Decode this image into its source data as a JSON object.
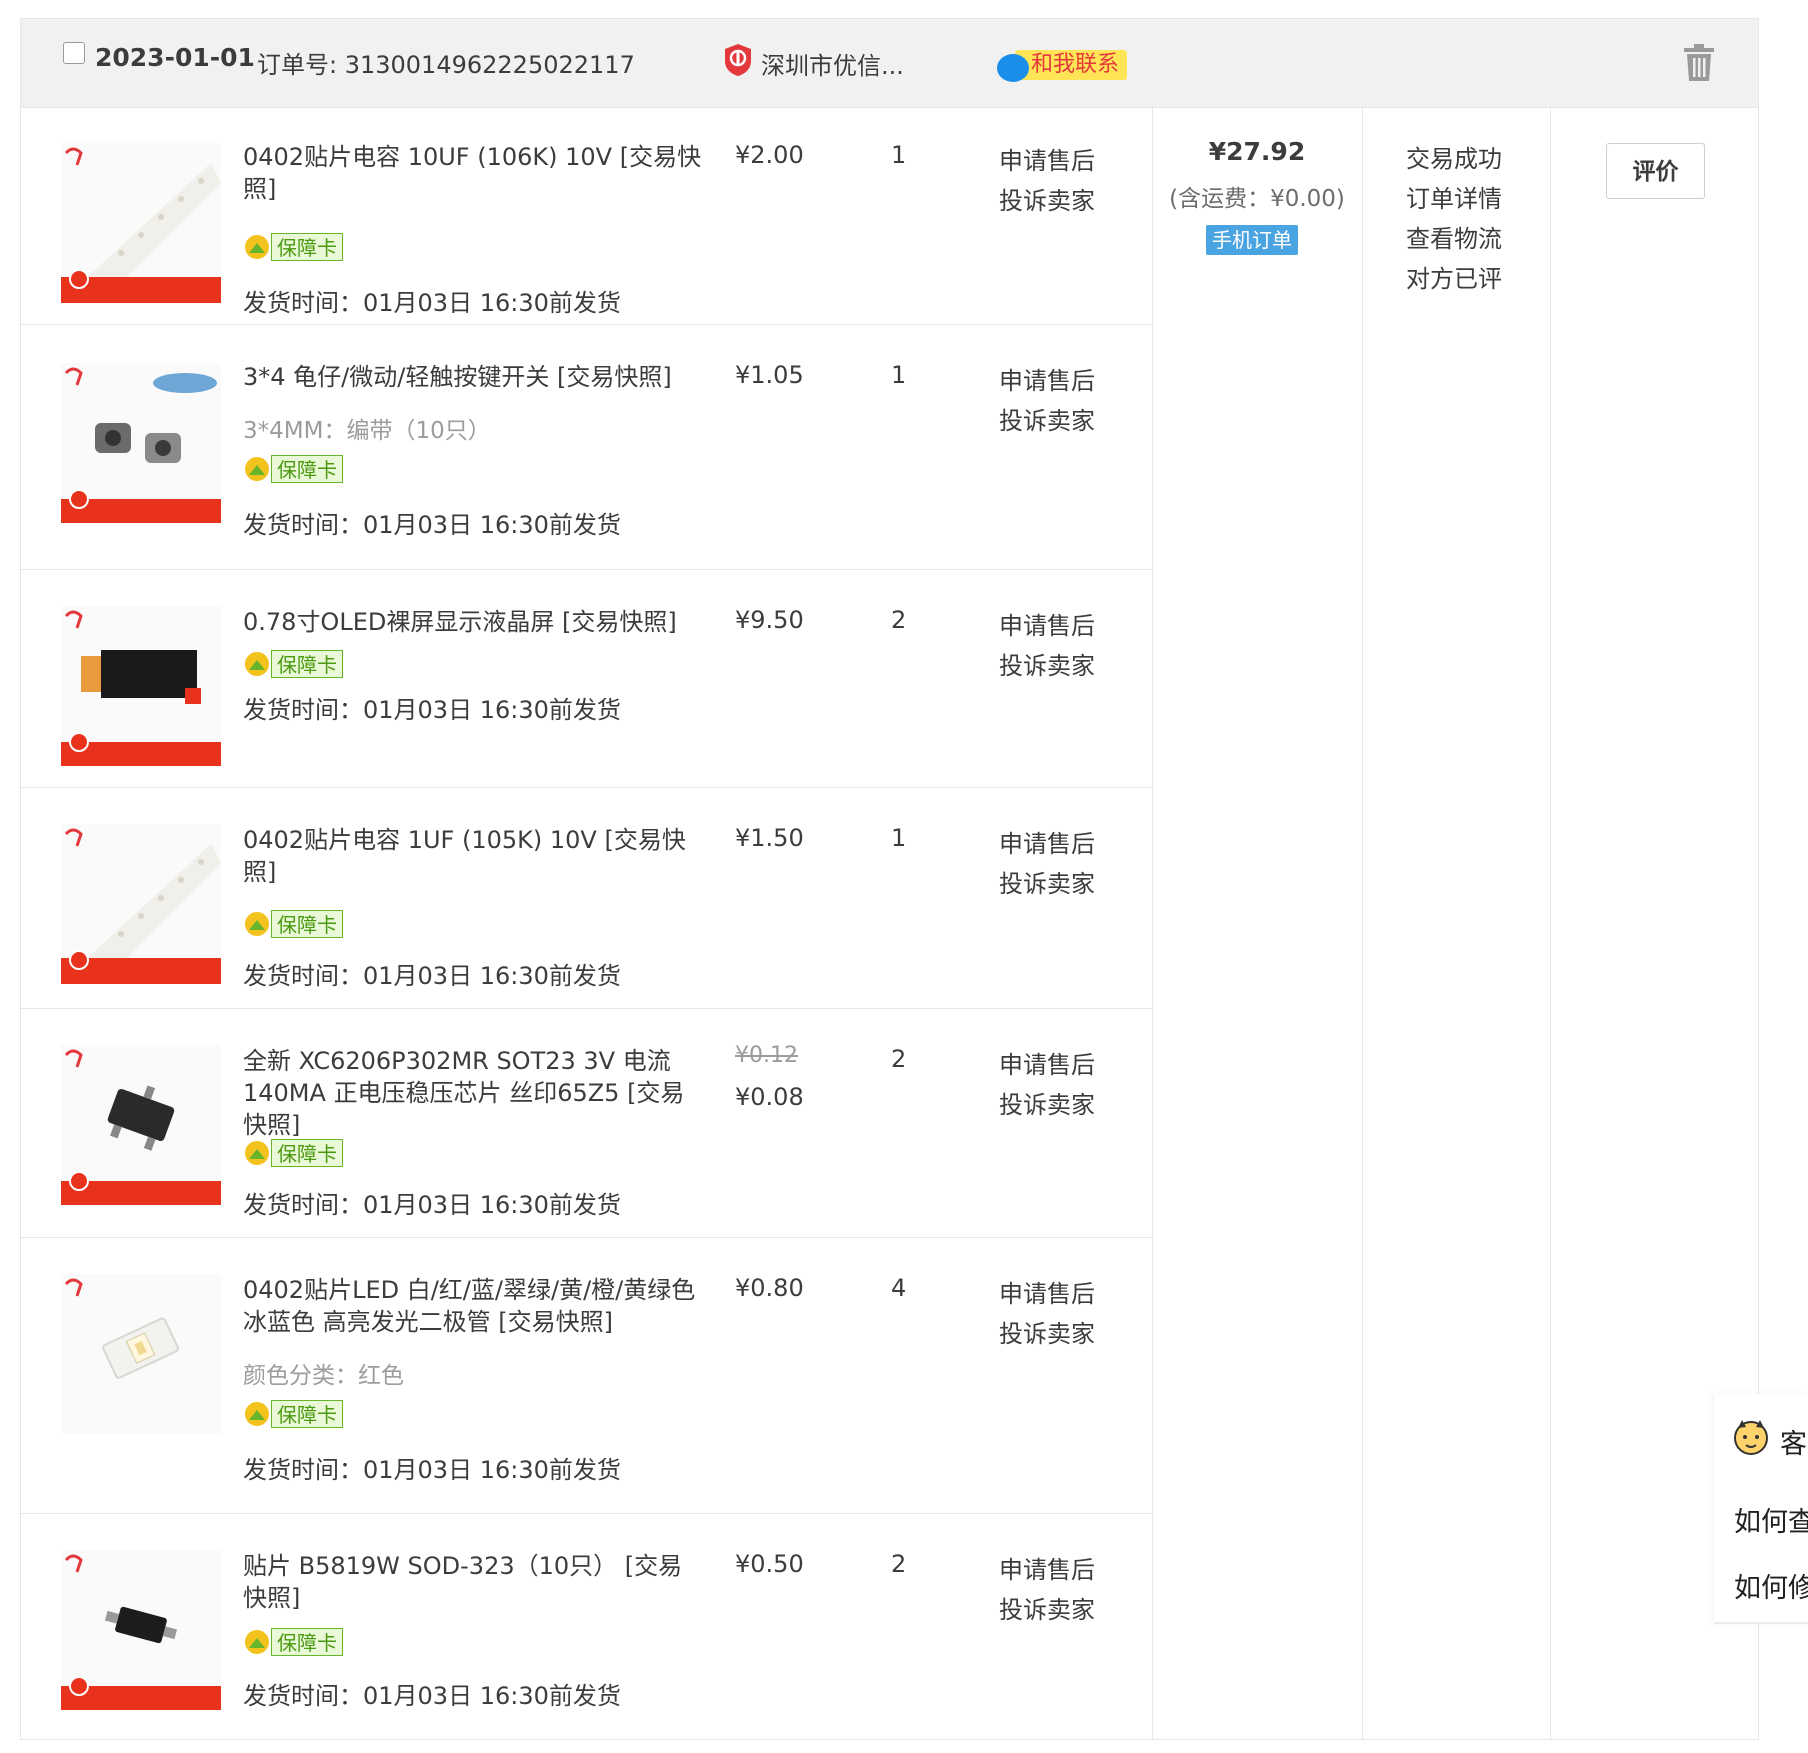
{
  "order": {
    "date": "2023-01-01",
    "order_no": "订单号: 3130014962225022117",
    "shop_name": "深圳市优信...",
    "chat_label": "和我联系",
    "total_price": "¥27.92",
    "shipping_note": "(含运费：¥0.00)",
    "mobile_badge": "手机订单",
    "status_lines": [
      "交易成功",
      "订单详情",
      "查看物流",
      "对方已评"
    ],
    "review_button": "评价",
    "items": [
      {
        "title": "0402贴片电容 10UF (106K) 10V [交易快照]",
        "sku": "",
        "guarantee": "保障卡",
        "ship_time": "发货时间：01月03日 16:30前发货",
        "price_old": "",
        "price": "¥2.00",
        "qty": "1",
        "after_sale": "申请售后",
        "complain": "投诉卖家"
      },
      {
        "title": "3*4 龟仔/微动/轻触按键开关 [交易快照]",
        "sku": "3*4MM：编带（10只）",
        "guarantee": "保障卡",
        "ship_time": "发货时间：01月03日 16:30前发货",
        "price_old": "",
        "price": "¥1.05",
        "qty": "1",
        "after_sale": "申请售后",
        "complain": "投诉卖家"
      },
      {
        "title": "0.78寸OLED裸屏显示液晶屏 [交易快照]",
        "sku": "",
        "guarantee": "保障卡",
        "ship_time": "发货时间：01月03日 16:30前发货",
        "price_old": "",
        "price": "¥9.50",
        "qty": "2",
        "after_sale": "申请售后",
        "complain": "投诉卖家"
      },
      {
        "title": "0402贴片电容 1UF (105K) 10V [交易快照]",
        "sku": "",
        "guarantee": "保障卡",
        "ship_time": "发货时间：01月03日 16:30前发货",
        "price_old": "",
        "price": "¥1.50",
        "qty": "1",
        "after_sale": "申请售后",
        "complain": "投诉卖家"
      },
      {
        "title": "全新 XC6206P302MR SOT23 3V 电流140MA 正电压稳压芯片 丝印65Z5 [交易快照]",
        "sku": "",
        "guarantee": "保障卡",
        "ship_time": "发货时间：01月03日 16:30前发货",
        "price_old": "¥0.12",
        "price": "¥0.08",
        "qty": "2",
        "after_sale": "申请售后",
        "complain": "投诉卖家"
      },
      {
        "title": "0402贴片LED 白/红/蓝/翠绿/黄/橙/黄绿色 冰蓝色 高亮发光二极管 [交易快照]",
        "sku": "颜色分类：红色",
        "guarantee": "保障卡",
        "ship_time": "发货时间：01月03日 16:30前发货",
        "price_old": "",
        "price": "¥0.80",
        "qty": "4",
        "after_sale": "申请售后",
        "complain": "投诉卖家"
      },
      {
        "title": "贴片 B5819W SOD-323（10只） [交易快照]",
        "sku": "",
        "guarantee": "保障卡",
        "ship_time": "发货时间：01月03日 16:30前发货",
        "price_old": "",
        "price": "¥0.50",
        "qty": "2",
        "after_sale": "申请售后",
        "complain": "投诉卖家"
      }
    ]
  },
  "help_panel": {
    "title": "客",
    "questions": [
      "如何查",
      "如何修"
    ]
  },
  "colors": {
    "header_bg": "#f1f1f1",
    "border": "#e6e6e6",
    "chat_bg": "#ffe455",
    "chat_text": "#e4393c",
    "mobile_badge": "#4ba4e2",
    "guarantee_green": "#67b52b",
    "thumb_red": "#e8321c"
  }
}
